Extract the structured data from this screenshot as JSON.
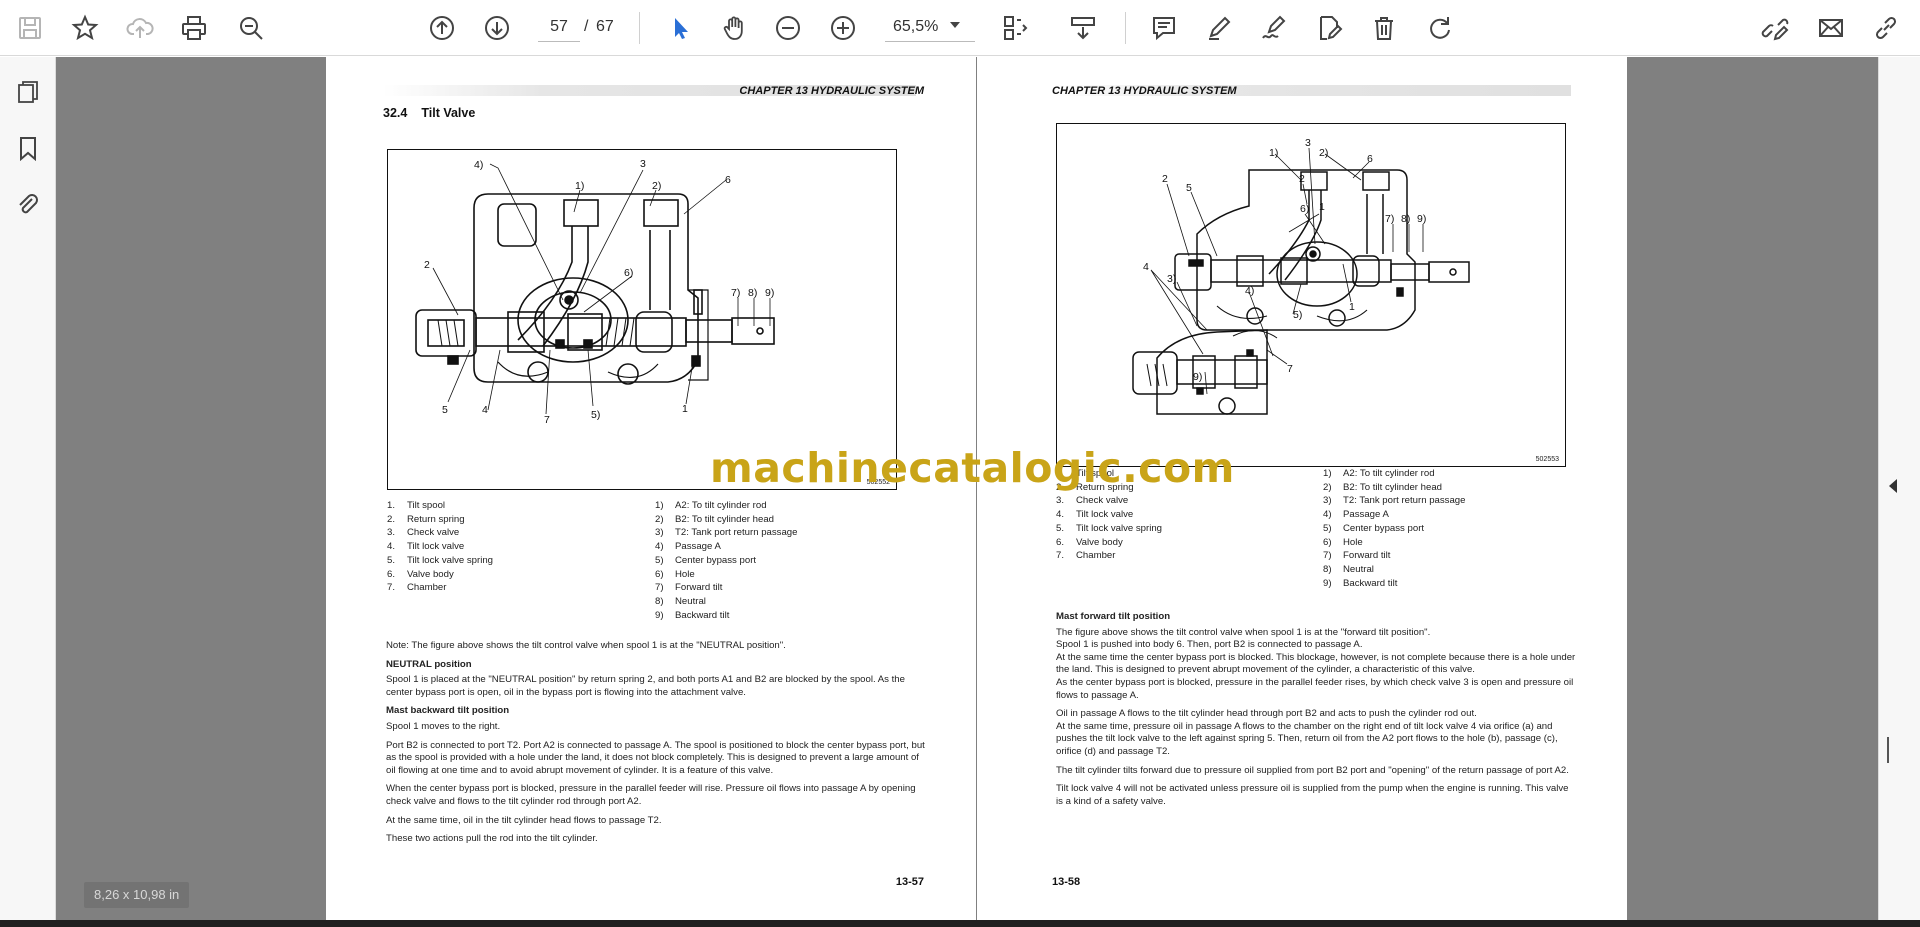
{
  "toolbar": {
    "current_page": "57",
    "page_separator": "/",
    "total_pages": "67",
    "zoom": "65,5%"
  },
  "size_label": "8,26 x 10,98 in",
  "watermark": "machinecatalogic.com",
  "left_page": {
    "chapter": "CHAPTER 13 HYDRAULIC SYSTEM",
    "section_number": "32.4",
    "section_title": "Tilt Valve",
    "figure_id": "502552",
    "figure_callouts": [
      "4)",
      "3",
      "1)",
      "2)",
      "6",
      "2",
      "6)",
      "7)",
      "8)",
      "9)",
      "5",
      "4",
      "7",
      "5)",
      "1"
    ],
    "parts": [
      {
        "n": "1.",
        "t": "Tilt spool"
      },
      {
        "n": "2.",
        "t": "Return spring"
      },
      {
        "n": "3.",
        "t": "Check valve"
      },
      {
        "n": "4.",
        "t": "Tilt lock valve"
      },
      {
        "n": "5.",
        "t": "Tilt lock valve spring"
      },
      {
        "n": "6.",
        "t": "Valve body"
      },
      {
        "n": "7.",
        "t": "Chamber"
      }
    ],
    "ports": [
      {
        "n": "1)",
        "t": "A2: To tilt cylinder rod"
      },
      {
        "n": "2)",
        "t": "B2: To tilt cylinder head"
      },
      {
        "n": "3)",
        "t": "T2: Tank port return passage"
      },
      {
        "n": "4)",
        "t": "Passage A"
      },
      {
        "n": "5)",
        "t": "Center bypass port"
      },
      {
        "n": "6)",
        "t": "Hole"
      },
      {
        "n": "7)",
        "t": "Forward tilt"
      },
      {
        "n": "8)",
        "t": "Neutral"
      },
      {
        "n": "9)",
        "t": "Backward tilt"
      }
    ],
    "note": "Note: The figure above shows the tilt control valve when spool 1 is at the \"NEUTRAL position\".",
    "neutral_heading": "NEUTRAL position",
    "neutral_text": "Spool 1 is placed at the \"NEUTRAL position\" by return spring 2, and both ports A1 and B2 are blocked by the spool. As the center bypass port is open, oil in the bypass port is flowing into the attachment valve.",
    "backward_heading": "Mast backward tilt position",
    "backward_p1": "Spool 1 moves to the right.",
    "backward_p2": "Port B2 is connected to port T2. Port A2 is connected to passage A. The spool is positioned to block the center bypass port, but as the spool is provided with a hole under the land, it does not block completely. This is designed to prevent a large amount of oil flowing at one time and to avoid abrupt movement of cylinder. It is a feature of this valve.",
    "backward_p3": "When the center bypass port is blocked, pressure in the parallel feeder will rise. Pressure oil flows into passage A by opening check valve and flows to the tilt cylinder rod through port A2.",
    "backward_p4": "At the same time, oil in the tilt cylinder head flows to passage T2.",
    "backward_p5": "These two actions pull the rod into the tilt cylinder.",
    "page_number": "13-57"
  },
  "right_page": {
    "chapter": "CHAPTER 13 HYDRAULIC SYSTEM",
    "figure_id": "502553",
    "figure_callouts": [
      "3",
      "1)",
      "2)",
      "6",
      "2",
      "5",
      "2",
      "1",
      "6)",
      "7)",
      "8)",
      "9)",
      "4",
      "3)",
      "4)",
      "5)",
      "1",
      "9)",
      "7"
    ],
    "parts": [
      {
        "n": "1.",
        "t": "Tilt spool"
      },
      {
        "n": "2.",
        "t": "Return spring"
      },
      {
        "n": "3.",
        "t": "Check valve"
      },
      {
        "n": "4.",
        "t": "Tilt lock valve"
      },
      {
        "n": "5.",
        "t": "Tilt lock valve spring"
      },
      {
        "n": "6.",
        "t": "Valve body"
      },
      {
        "n": "7.",
        "t": "Chamber"
      }
    ],
    "ports": [
      {
        "n": "1)",
        "t": "A2: To tilt cylinder rod"
      },
      {
        "n": "2)",
        "t": "B2: To tilt cylinder head"
      },
      {
        "n": "3)",
        "t": "T2: Tank port return passage"
      },
      {
        "n": "4)",
        "t": "Passage A"
      },
      {
        "n": "5)",
        "t": "Center bypass port"
      },
      {
        "n": "6)",
        "t": "Hole"
      },
      {
        "n": "7)",
        "t": "Forward tilt"
      },
      {
        "n": "8)",
        "t": "Neutral"
      },
      {
        "n": "9)",
        "t": "Backward tilt"
      }
    ],
    "forward_heading": "Mast forward tilt position",
    "forward_p1": "The figure above shows the tilt control valve when spool 1 is at the \"forward tilt position\".",
    "forward_p2": "Spool 1 is pushed into body 6. Then, port B2 is connected to passage A.",
    "forward_p3": "At the same time the center bypass port is blocked. This blockage, however, is not complete because there is a hole under the land. This is designed to prevent abrupt movement of the cylinder, a characteristic of this valve.",
    "forward_p4": "As the center bypass port is blocked, pressure in the parallel feeder rises, by which check valve 3 is open and pressure oil flows to passage A.",
    "forward_p5": "Oil in passage A flows to the tilt cylinder head through port B2 and acts to push the cylinder rod out.",
    "forward_p6": "At the same time, pressure oil in passage A flows to the chamber on the right end of tilt lock valve 4 via orifice (a) and pushes the tilt lock valve to the left against spring 5. Then, return oil from the A2 port flows to the hole (b), passage (c), orifice (d) and passage T2.",
    "forward_p7": "The tilt cylinder tilts forward due to pressure oil supplied from port B2 port and \"opening\" of the return passage of port A2.",
    "forward_p8": "Tilt lock valve 4 will not be activated unless pressure oil is supplied from the pump when the engine is running. This valve is a kind of a safety valve.",
    "page_number": "13-58"
  }
}
